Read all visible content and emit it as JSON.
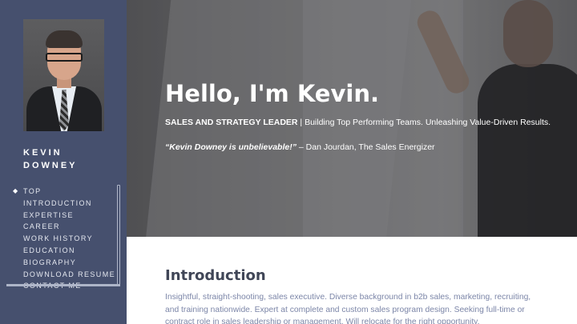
{
  "sidebar": {
    "name_first": "KEVIN",
    "name_last": "DOWNEY",
    "nav": [
      {
        "label": "TOP",
        "active": true
      },
      {
        "label": "INTRODUCTION"
      },
      {
        "label": "EXPERTISE"
      },
      {
        "label": "CAREER"
      },
      {
        "label": "WORK HISTORY"
      },
      {
        "label": "EDUCATION"
      },
      {
        "label": "BIOGRAPHY"
      },
      {
        "label": "DOWNLOAD RESUME"
      },
      {
        "label": "CONTACT ME"
      }
    ],
    "active_bullet": "◆"
  },
  "hero": {
    "title": "Hello, I'm Kevin.",
    "role": "SALES AND STRATEGY LEADER",
    "separator": " | ",
    "tagline": "Building Top Performing Teams. Unleashing Value-Driven Results.",
    "quote": "“Kevin Downey is unbelievable!”",
    "quote_attribution": " – Dan Jourdan, The Sales Energizer"
  },
  "intro": {
    "heading": "Introduction",
    "body": "Insightful, straight-shooting, sales executive. Diverse background in b2b sales, marketing, recruiting, and training nationwide. Expert at complete and custom sales program design. Seeking full-time or contract role in sales leadership or management. Will relocate for the right opportunity."
  },
  "colors": {
    "sidebar_bg": "#46506e",
    "intro_heading": "#404657",
    "intro_text": "#7c86a8"
  }
}
